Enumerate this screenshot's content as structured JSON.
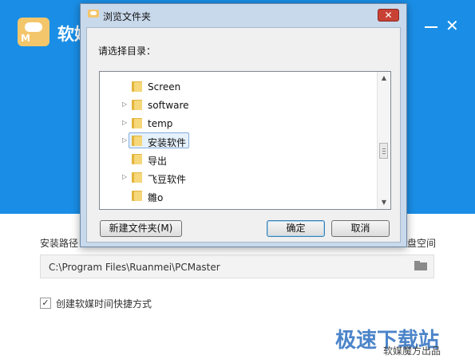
{
  "installer": {
    "title": "软媒",
    "install_path_label": "安装路径",
    "disk_space_label": "盘空间",
    "install_path_value": "C:\\Program Files\\Ruanmei\\PCMaster",
    "shortcut_checkbox": {
      "label": "创建软媒时间快捷方式",
      "checked": true,
      "mark": "✓"
    },
    "window_controls": {
      "minimize": "—",
      "close": "✕"
    },
    "watermark": "极速下载站",
    "watermark_sub": "软媒魔方出品"
  },
  "dialog": {
    "title": "浏览文件夹",
    "close_glyph": "✕",
    "prompt": "请选择目录：",
    "tree_items": [
      {
        "label": "Screen",
        "has_children": false,
        "selected": false
      },
      {
        "label": "software",
        "has_children": true,
        "selected": false
      },
      {
        "label": "temp",
        "has_children": true,
        "selected": false
      },
      {
        "label": "安装软件",
        "has_children": true,
        "selected": true
      },
      {
        "label": "导出",
        "has_children": false,
        "selected": false
      },
      {
        "label": "飞豆软件",
        "has_children": true,
        "selected": false
      },
      {
        "label": "雛o",
        "has_children": false,
        "selected": false
      }
    ],
    "scroll_up": "▲",
    "scroll_down": "▼",
    "expander_glyph": "▷",
    "buttons": {
      "new_folder": "新建文件夹(M)",
      "ok": "确定",
      "cancel": "取消"
    }
  },
  "colors": {
    "header_blue": "#1a8ee6",
    "dialog_frame": "#c9d9ec",
    "close_red": "#c94135"
  }
}
